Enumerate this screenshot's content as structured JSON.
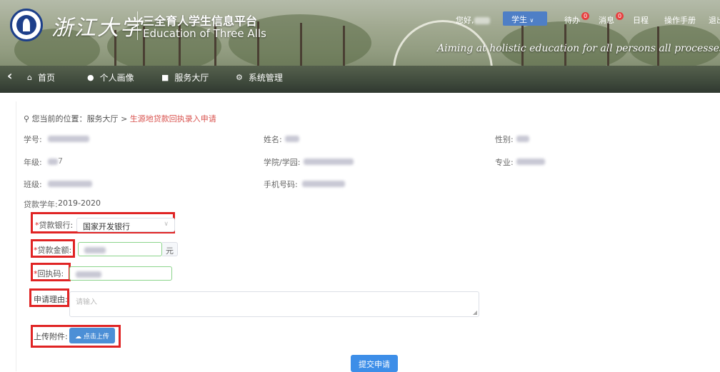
{
  "header": {
    "logo_text": "浙江大学",
    "platform_title_cn": "三全育人学生信息平台",
    "platform_title_en": "Education of Three Alls",
    "slogan": "Aiming at holistic education for all persons all processes and all directions",
    "greeting": "您好,",
    "role_select": "学生",
    "todo_label": "待办",
    "todo_count": "0",
    "message_label": "消息",
    "message_count": "0",
    "schedule_label": "日程",
    "manual_label": "操作手册",
    "logout_label": "退出"
  },
  "nav": {
    "items": [
      {
        "label": "首页",
        "icon": "home-icon"
      },
      {
        "label": "个人画像",
        "icon": "user-icon"
      },
      {
        "label": "服务大厅",
        "icon": "briefcase-icon"
      },
      {
        "label": "系统管理",
        "icon": "gears-icon"
      }
    ]
  },
  "breadcrumb": {
    "prefix": "您当前的位置：",
    "parent": "服务大厅",
    "separator": ">",
    "current": "生源地贷款回执录入申请"
  },
  "info": {
    "student_id_label": "学号:",
    "name_label": "姓名:",
    "gender_label": "性别:",
    "grade_label": "年级:",
    "grade_value_visible": "7",
    "college_label": "学院/学园:",
    "major_label": "专业:",
    "class_label": "班级:",
    "phone_label": "手机号码:",
    "loan_year_label": "贷款学年:",
    "loan_year_value": "2019-2020"
  },
  "form": {
    "bank_label": "贷款银行:",
    "bank_value": "国家开发银行",
    "amount_label": "贷款金额:",
    "amount_unit": "元",
    "receipt_label": "回执码:",
    "reason_label": "申请理由:",
    "reason_placeholder": "请输入",
    "attach_label": "上传附件:",
    "upload_label": "点击上传",
    "submit_label": "提交申请",
    "required_mark": "*"
  },
  "colors": {
    "highlight_box": "#e02424",
    "primary_button": "#3d8ee8",
    "breadcrumb_current": "#d9534f",
    "badge": "#e64040"
  }
}
